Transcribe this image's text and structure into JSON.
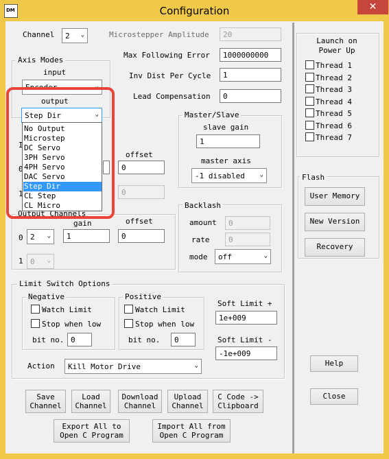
{
  "window": {
    "title": "Configuration",
    "icon_text": "DM",
    "close_glyph": "✕"
  },
  "channel": {
    "label": "Channel",
    "value": "2"
  },
  "axis_modes": {
    "title": "Axis Modes",
    "input_label": "input",
    "input_value": "Encoder",
    "output_label": "output",
    "output_value": "Step Dir"
  },
  "output_dropdown": {
    "options": [
      "No Output",
      "Microstep",
      "DC Servo",
      "3PH Servo",
      "4PH Servo",
      "DAC Servo",
      "Step Dir",
      "CL Step",
      "CL Micro"
    ],
    "selected": "Step Dir"
  },
  "params": {
    "microstepper_amplitude": {
      "label": "Microstepper Amplitude",
      "value": "20"
    },
    "max_following_error": {
      "label": "Max Following Error",
      "value": "1000000000"
    },
    "inv_dist_per_cycle": {
      "label": "Inv Dist Per Cycle",
      "value": "1"
    },
    "lead_compensation": {
      "label": "Lead Compensation",
      "value": "0"
    }
  },
  "input_channels": {
    "label_prefix": "I",
    "offset_label": "offset",
    "row0_prefix": "0",
    "row0_offset": "0",
    "row1_prefix": "1",
    "row1_offset": "0"
  },
  "master_slave": {
    "title": "Master/Slave",
    "slave_gain_label": "slave gain",
    "slave_gain": "1",
    "master_axis_label": "master axis",
    "master_axis": "-1 disabled"
  },
  "output_channels": {
    "title": "Output Channels",
    "gain_label": "gain",
    "offset_label": "offset",
    "row0_label": "0",
    "row0_channel": "2",
    "row0_gain": "1",
    "row0_offset": "0",
    "row1_label": "1",
    "row1_channel": "0"
  },
  "backlash": {
    "title": "Backlash",
    "amount_label": "amount",
    "amount": "0",
    "rate_label": "rate",
    "rate": "0",
    "mode_label": "mode",
    "mode": "off"
  },
  "limit_switch": {
    "title": "Limit Switch Options",
    "negative": {
      "title": "Negative",
      "watch_limit": "Watch Limit",
      "stop_when_low": "Stop when low",
      "bit_no_label": "bit no.",
      "bit_no": "0"
    },
    "positive": {
      "title": "Positive",
      "watch_limit": "Watch Limit",
      "stop_when_low": "Stop when low",
      "bit_no_label": "bit no.",
      "bit_no": "0"
    },
    "soft_limit_plus_label": "Soft Limit +",
    "soft_limit_plus": "1e+009",
    "soft_limit_minus_label": "Soft Limit -",
    "soft_limit_minus": "-1e+009",
    "action_label": "Action",
    "action_value": "Kill Motor Drive"
  },
  "launch_on_power_up": {
    "title": "Launch on\nPower Up",
    "threads": [
      "Thread 1",
      "Thread 2",
      "Thread 3",
      "Thread 4",
      "Thread 5",
      "Thread 6",
      "Thread 7"
    ]
  },
  "flash": {
    "title": "Flash",
    "user_memory": "User Memory",
    "new_version": "New Version",
    "recovery": "Recovery"
  },
  "buttons": {
    "save_channel": "Save\nChannel",
    "load_channel": "Load\nChannel",
    "download_channel": "Download\nChannel",
    "upload_channel": "Upload\nChannel",
    "c_code_clipboard": "C Code ->\nClipboard",
    "export_all": "Export All to\nOpen C Program",
    "import_all": "Import All from\nOpen C Program",
    "help": "Help",
    "close": "Close"
  },
  "colors": {
    "highlight": "#e8443a",
    "selection": "#3399ff",
    "frame": "#f0c94a"
  }
}
